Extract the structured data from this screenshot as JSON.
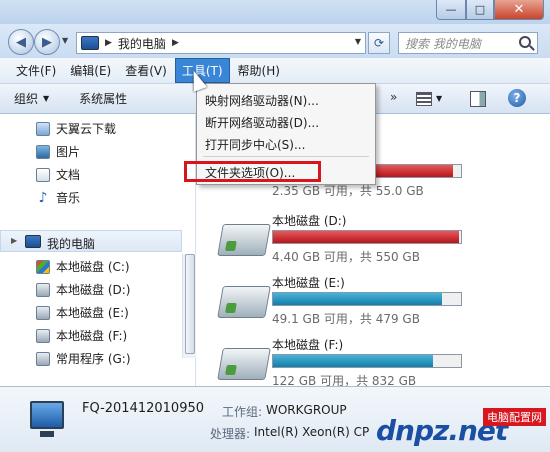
{
  "window": {
    "minimize_glyph": "—",
    "maximize_glyph": "□",
    "close_glyph": "✕"
  },
  "address": {
    "location": "我的电脑",
    "search_placeholder": "搜索 我的电脑"
  },
  "menubar": {
    "items": [
      "文件(F)",
      "编辑(E)",
      "查看(V)",
      "工具(T)",
      "帮助(H)"
    ],
    "active": "工具(T)"
  },
  "commandbar": {
    "organize": "组织",
    "system_properties": "系统属性",
    "more": "»"
  },
  "nav": {
    "items": [
      "天翼云下载",
      "图片",
      "文档",
      "音乐"
    ],
    "computer": "我的电脑",
    "drives": [
      "本地磁盘 (C:)",
      "本地磁盘 (D:)",
      "本地磁盘 (E:)",
      "本地磁盘 (F:)",
      "常用程序 (G:)"
    ]
  },
  "tools_menu": {
    "items": [
      "映射网络驱动器(N)...",
      "断开网络驱动器(D)...",
      "打开同步中心(S)...",
      "文件夹选项(O)..."
    ],
    "highlighted": "文件夹选项(O)..."
  },
  "drives": [
    {
      "name": "",
      "info": "2.35 GB 可用，共 55.0 GB",
      "used_fraction": 0.96,
      "color": "#c0141a"
    },
    {
      "name": "本地磁盘 (D:)",
      "info": "4.40 GB 可用，共 550 GB",
      "used_fraction": 0.99,
      "color": "#c0141a"
    },
    {
      "name": "本地磁盘 (E:)",
      "info": "49.1 GB 可用，共 479 GB",
      "used_fraction": 0.9,
      "color": "#137ea8"
    },
    {
      "name": "本地磁盘 (F:)",
      "info": "122 GB 可用，共 832 GB",
      "used_fraction": 0.85,
      "color": "#137ea8"
    }
  ],
  "details": {
    "computer_name": "FQ-201412010950",
    "workgroup_label": "工作组:",
    "workgroup_value": "WORKGROUP",
    "cpu_label": "处理器:",
    "cpu_value": "Intel(R) Xeon(R) CP"
  },
  "watermark": {
    "logo": "dnpz.net",
    "badge": "电脑配置网"
  }
}
